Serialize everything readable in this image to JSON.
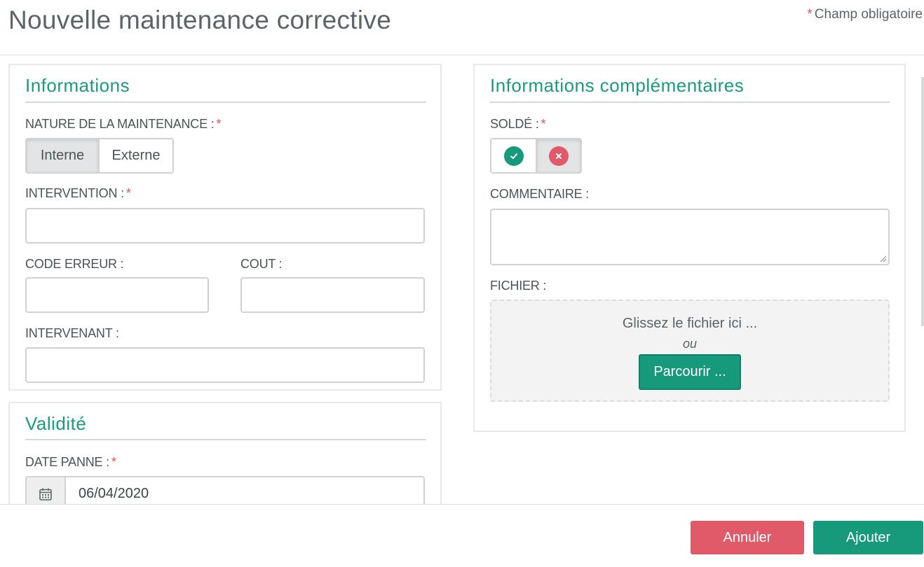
{
  "header": {
    "title": "Nouvelle maintenance corrective",
    "required_star": "*",
    "required_note": "Champ obligatoire"
  },
  "informations": {
    "title": "Informations",
    "nature_label": "NATURE DE LA MAINTENANCE :",
    "nature_options": [
      "Interne",
      "Externe"
    ],
    "nature_selected": "Interne",
    "intervention_label": "INTERVENTION :",
    "intervention_value": "",
    "code_erreur_label": "CODE ERREUR :",
    "code_erreur_value": "",
    "cout_label": "COUT :",
    "cout_value": "",
    "intervenant_label": "INTERVENANT :",
    "intervenant_value": ""
  },
  "validite": {
    "title": "Validité",
    "date_panne_label": "DATE PANNE :",
    "date_panne_value": "06/04/2020",
    "calendar_icon": "calendar-icon"
  },
  "complementaires": {
    "title": "Informations complémentaires",
    "solde_label": "SOLDÉ :",
    "solde_options": [
      "check-icon",
      "close-icon"
    ],
    "solde_selected": "close-icon",
    "commentaire_label": "COMMENTAIRE :",
    "commentaire_value": "",
    "fichier_label": "FICHIER :",
    "dropzone_text": "Glissez le fichier ici ...",
    "dropzone_or": "ou",
    "browse_label": "Parcourir ..."
  },
  "footer": {
    "cancel_label": "Annuler",
    "add_label": "Ajouter"
  },
  "colors": {
    "accent": "#179a7b",
    "danger": "#e05a6a",
    "title_green": "#1a9a7e"
  }
}
